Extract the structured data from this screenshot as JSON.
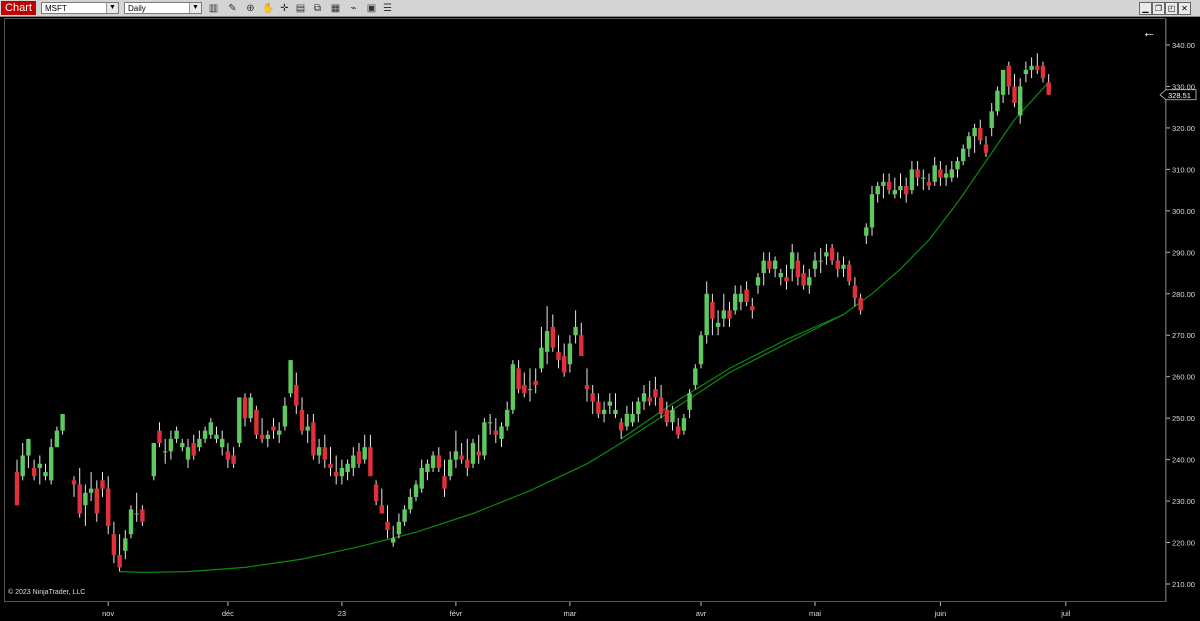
{
  "toolbar": {
    "chart_tab": "Chart",
    "symbol": "MSFT",
    "interval": "Daily",
    "icons": [
      "bar-type-icon",
      "pencil-icon",
      "zoom-icon",
      "hand-icon",
      "crosshair-icon",
      "data-box-icon",
      "instrument-link-icon",
      "chart-trader-icon",
      "strategy-icon",
      "indicators-icon",
      "properties-icon",
      "list-icon"
    ],
    "window_icons": [
      "minimize-icon",
      "restore-icon",
      "maximize-icon",
      "close-icon"
    ]
  },
  "copyright": "© 2023 NinjaTrader, LLC",
  "current_price": "328.51",
  "back_arrow": "←",
  "chart_data": {
    "type": "candlestick",
    "symbol": "MSFT",
    "interval": "Daily",
    "price_ticks": [
      "210.00",
      "220.00",
      "230.00",
      "240.00",
      "250.00",
      "260.00",
      "270.00",
      "280.00",
      "290.00",
      "300.00",
      "310.00",
      "320.00",
      "330.00",
      "340.00"
    ],
    "ylim": [
      208,
      344
    ],
    "time_labels": [
      {
        "label": "nov",
        "index": 16
      },
      {
        "label": "déc",
        "index": 37
      },
      {
        "label": "23",
        "index": 57
      },
      {
        "label": "févr",
        "index": 77
      },
      {
        "label": "mar",
        "index": 97
      },
      {
        "label": "avr",
        "index": 120
      },
      {
        "label": "mai",
        "index": 140
      },
      {
        "label": "juin",
        "index": 162
      },
      {
        "label": "juil",
        "index": 184
      }
    ],
    "bar_count": 190,
    "up_color": "#5fc85f",
    "down_color": "#e0313a",
    "curve_color": "#0d8a0d",
    "candles": [
      [
        0,
        237,
        240,
        229,
        229
      ],
      [
        1,
        236,
        244,
        235,
        241
      ],
      [
        2,
        241,
        245,
        238,
        245
      ],
      [
        3,
        238,
        240,
        235,
        236
      ],
      [
        4,
        238,
        241,
        234,
        239
      ],
      [
        5,
        236,
        239,
        235,
        237
      ],
      [
        6,
        235,
        245,
        234,
        243
      ],
      [
        7,
        243,
        248,
        243,
        247
      ],
      [
        8,
        247,
        251,
        246,
        251
      ],
      [
        10,
        235,
        236,
        231,
        234
      ],
      [
        11,
        234,
        238,
        226,
        227
      ],
      [
        12,
        229,
        234,
        224,
        232
      ],
      [
        13,
        232,
        237,
        230,
        233
      ],
      [
        14,
        233,
        235,
        225,
        227
      ],
      [
        15,
        235,
        237,
        231,
        233
      ],
      [
        16,
        233,
        236,
        222,
        224
      ],
      [
        17,
        222,
        225,
        215,
        217
      ],
      [
        18,
        217,
        222,
        213,
        214
      ],
      [
        19,
        218,
        223,
        216,
        221
      ],
      [
        20,
        222,
        229,
        221,
        228
      ],
      [
        21,
        227,
        232,
        225,
        227
      ],
      [
        22,
        228,
        229,
        224,
        225
      ],
      [
        24,
        236,
        244,
        235,
        244
      ],
      [
        25,
        247,
        249,
        243,
        244
      ],
      [
        26,
        242,
        245,
        239,
        242
      ],
      [
        27,
        242,
        247,
        240,
        245
      ],
      [
        28,
        245,
        248,
        244,
        247
      ],
      [
        29,
        243,
        245,
        242,
        244
      ],
      [
        30,
        240,
        245,
        238,
        243
      ],
      [
        31,
        244,
        246,
        240,
        241
      ],
      [
        32,
        243,
        247,
        242,
        245
      ],
      [
        33,
        245,
        248,
        244,
        247
      ],
      [
        34,
        246,
        250,
        245,
        249
      ],
      [
        35,
        245,
        248,
        244,
        246
      ],
      [
        36,
        243,
        247,
        241,
        245
      ],
      [
        37,
        242,
        244,
        238,
        240
      ],
      [
        38,
        241,
        243,
        238,
        239
      ],
      [
        39,
        244,
        255,
        243,
        255
      ],
      [
        40,
        255,
        256,
        248,
        250
      ],
      [
        41,
        250,
        256,
        249,
        255
      ],
      [
        42,
        252,
        253,
        245,
        246
      ],
      [
        43,
        246,
        250,
        244,
        245
      ],
      [
        44,
        245,
        247,
        243,
        246
      ],
      [
        45,
        248,
        250,
        245,
        247
      ],
      [
        46,
        246,
        249,
        244,
        247
      ],
      [
        47,
        248,
        255,
        247,
        253
      ],
      [
        48,
        256,
        264,
        255,
        264
      ],
      [
        49,
        258,
        261,
        251,
        253
      ],
      [
        50,
        252,
        255,
        246,
        247
      ],
      [
        51,
        247,
        251,
        244,
        248
      ],
      [
        52,
        249,
        251,
        240,
        241
      ],
      [
        53,
        241,
        245,
        239,
        243
      ],
      [
        54,
        243,
        246,
        238,
        240
      ],
      [
        55,
        239,
        243,
        236,
        238
      ],
      [
        56,
        237,
        241,
        234,
        236
      ],
      [
        57,
        236,
        240,
        234,
        238
      ],
      [
        58,
        237,
        240,
        235,
        239
      ],
      [
        59,
        238,
        243,
        236,
        241
      ],
      [
        60,
        242,
        244,
        238,
        239
      ],
      [
        61,
        240,
        246,
        239,
        243
      ],
      [
        62,
        243,
        246,
        236,
        236
      ],
      [
        63,
        234,
        235,
        229,
        230
      ],
      [
        64,
        229,
        233,
        227,
        227
      ],
      [
        65,
        225,
        229,
        221,
        223
      ],
      [
        66,
        220,
        224,
        219,
        221
      ],
      [
        67,
        222,
        227,
        221,
        225
      ],
      [
        68,
        225,
        229,
        224,
        228
      ],
      [
        69,
        228,
        233,
        227,
        231
      ],
      [
        70,
        231,
        235,
        230,
        234
      ],
      [
        71,
        233,
        240,
        232,
        238
      ],
      [
        72,
        237,
        240,
        235,
        239
      ],
      [
        73,
        238,
        242,
        237,
        241
      ],
      [
        74,
        241,
        243,
        237,
        238
      ],
      [
        75,
        236,
        240,
        231,
        233
      ],
      [
        76,
        236,
        242,
        235,
        240
      ],
      [
        77,
        240,
        247,
        238,
        242
      ],
      [
        78,
        241,
        244,
        239,
        240
      ],
      [
        79,
        240,
        245,
        236,
        238
      ],
      [
        80,
        239,
        245,
        238,
        244
      ],
      [
        81,
        242,
        246,
        239,
        241
      ],
      [
        82,
        241,
        250,
        240,
        249
      ],
      [
        83,
        249,
        251,
        246,
        249
      ],
      [
        84,
        247,
        250,
        244,
        246
      ],
      [
        85,
        245,
        249,
        243,
        248
      ],
      [
        86,
        248,
        254,
        247,
        252
      ],
      [
        87,
        252,
        264,
        251,
        263
      ],
      [
        88,
        262,
        264,
        256,
        257
      ],
      [
        89,
        258,
        261,
        255,
        256
      ],
      [
        90,
        257,
        262,
        254,
        257
      ],
      [
        91,
        259,
        262,
        256,
        258
      ],
      [
        92,
        262,
        272,
        261,
        267
      ],
      [
        93,
        266,
        277,
        263,
        271
      ],
      [
        94,
        272,
        275,
        266,
        267
      ],
      [
        95,
        266,
        270,
        262,
        264
      ],
      [
        96,
        265,
        268,
        260,
        261
      ],
      [
        97,
        263,
        270,
        261,
        268
      ],
      [
        98,
        270,
        276,
        268,
        272
      ],
      [
        99,
        270,
        273,
        265,
        265
      ],
      [
        100,
        258,
        262,
        254,
        257
      ],
      [
        101,
        256,
        258,
        251,
        254
      ],
      [
        102,
        254,
        256,
        250,
        251
      ],
      [
        103,
        251,
        254,
        249,
        252
      ],
      [
        104,
        253,
        256,
        251,
        254
      ],
      [
        105,
        251,
        256,
        250,
        252
      ],
      [
        106,
        249,
        250,
        245,
        247
      ],
      [
        107,
        248,
        253,
        247,
        251
      ],
      [
        108,
        249,
        254,
        248,
        251
      ],
      [
        109,
        251,
        255,
        249,
        254
      ],
      [
        110,
        254,
        258,
        252,
        256
      ],
      [
        111,
        255,
        259,
        253,
        254
      ],
      [
        112,
        257,
        260,
        253,
        255
      ],
      [
        113,
        255,
        258,
        250,
        251
      ],
      [
        114,
        252,
        254,
        248,
        249
      ],
      [
        115,
        249,
        253,
        247,
        252
      ],
      [
        116,
        248,
        250,
        245,
        246
      ],
      [
        117,
        247,
        251,
        246,
        250
      ],
      [
        118,
        252,
        257,
        250,
        256
      ],
      [
        119,
        258,
        263,
        257,
        262
      ],
      [
        120,
        263,
        271,
        262,
        270
      ],
      [
        121,
        270,
        283,
        268,
        280
      ],
      [
        122,
        278,
        280,
        270,
        274
      ],
      [
        123,
        272,
        276,
        270,
        273
      ],
      [
        124,
        274,
        280,
        272,
        276
      ],
      [
        125,
        276,
        278,
        272,
        274
      ],
      [
        126,
        276,
        282,
        275,
        280
      ],
      [
        127,
        278,
        282,
        276,
        280
      ],
      [
        128,
        281,
        283,
        277,
        278
      ],
      [
        129,
        277,
        279,
        274,
        276
      ],
      [
        130,
        282,
        285,
        280,
        284
      ],
      [
        131,
        285,
        290,
        282,
        288
      ],
      [
        132,
        288,
        290,
        285,
        286
      ],
      [
        133,
        286,
        289,
        284,
        288
      ],
      [
        134,
        284,
        286,
        282,
        285
      ],
      [
        135,
        284,
        287,
        281,
        283
      ],
      [
        136,
        286,
        292,
        283,
        290
      ],
      [
        137,
        288,
        290,
        282,
        284
      ],
      [
        138,
        285,
        287,
        281,
        282
      ],
      [
        139,
        282,
        286,
        280,
        284
      ],
      [
        140,
        286,
        290,
        284,
        288
      ],
      [
        141,
        288,
        291,
        285,
        288
      ],
      [
        142,
        289,
        292,
        287,
        290
      ],
      [
        143,
        291,
        292,
        287,
        288
      ],
      [
        144,
        288,
        290,
        284,
        286
      ],
      [
        145,
        286,
        289,
        284,
        287
      ],
      [
        146,
        287,
        288,
        282,
        283
      ],
      [
        147,
        282,
        284,
        277,
        279
      ],
      [
        148,
        279,
        280,
        275,
        276
      ],
      [
        149,
        294,
        297,
        292,
        296
      ],
      [
        150,
        296,
        306,
        294,
        304
      ],
      [
        151,
        304,
        307,
        302,
        306
      ],
      [
        152,
        306,
        309,
        303,
        307
      ],
      [
        153,
        307,
        309,
        304,
        305
      ],
      [
        154,
        304,
        308,
        303,
        305
      ],
      [
        155,
        305,
        309,
        303,
        306
      ],
      [
        156,
        306,
        308,
        302,
        304
      ],
      [
        157,
        305,
        312,
        304,
        310
      ],
      [
        158,
        310,
        312,
        306,
        308
      ],
      [
        159,
        308,
        310,
        305,
        308
      ],
      [
        160,
        307,
        309,
        305,
        306
      ],
      [
        161,
        307,
        313,
        306,
        311
      ],
      [
        162,
        310,
        312,
        306,
        308
      ],
      [
        163,
        308,
        311,
        306,
        309
      ],
      [
        164,
        308,
        312,
        307,
        310
      ],
      [
        165,
        310,
        313,
        308,
        312
      ],
      [
        166,
        312,
        316,
        311,
        315
      ],
      [
        167,
        315,
        319,
        313,
        318
      ],
      [
        168,
        318,
        321,
        314,
        320
      ],
      [
        169,
        320,
        322,
        316,
        317
      ],
      [
        170,
        316,
        318,
        313,
        314
      ],
      [
        171,
        320,
        326,
        318,
        324
      ],
      [
        172,
        324,
        330,
        323,
        329
      ],
      [
        173,
        328,
        334,
        326,
        334
      ],
      [
        174,
        335,
        336,
        328,
        330
      ],
      [
        175,
        330,
        333,
        325,
        326
      ],
      [
        176,
        323,
        332,
        321,
        330
      ],
      [
        177,
        333,
        336,
        331,
        334
      ],
      [
        178,
        334,
        337,
        332,
        335
      ],
      [
        179,
        335,
        338,
        333,
        334
      ],
      [
        180,
        335,
        336,
        331,
        332
      ],
      [
        181,
        331,
        333,
        328,
        328
      ]
    ],
    "curves": [
      {
        "name": "",
        "points": [
          [
            18,
            213
          ],
          [
            22,
            212.8
          ],
          [
            30,
            213
          ],
          [
            40,
            214
          ],
          [
            50,
            216
          ],
          [
            60,
            219
          ],
          [
            70,
            222.5
          ],
          [
            80,
            227
          ],
          [
            90,
            232.5
          ],
          [
            100,
            239
          ],
          [
            106,
            244
          ],
          [
            115,
            252
          ],
          [
            125,
            261
          ],
          [
            135,
            268
          ],
          [
            145,
            275
          ],
          [
            150,
            280
          ],
          [
            155,
            286
          ],
          [
            160,
            293
          ],
          [
            165,
            302
          ],
          [
            170,
            312
          ],
          [
            175,
            322
          ],
          [
            181,
            331
          ]
        ]
      },
      {
        "name": "",
        "points": [
          [
            106,
            245
          ],
          [
            115,
            253.5
          ],
          [
            125,
            262
          ],
          [
            135,
            269
          ],
          [
            145,
            275
          ]
        ]
      }
    ]
  }
}
